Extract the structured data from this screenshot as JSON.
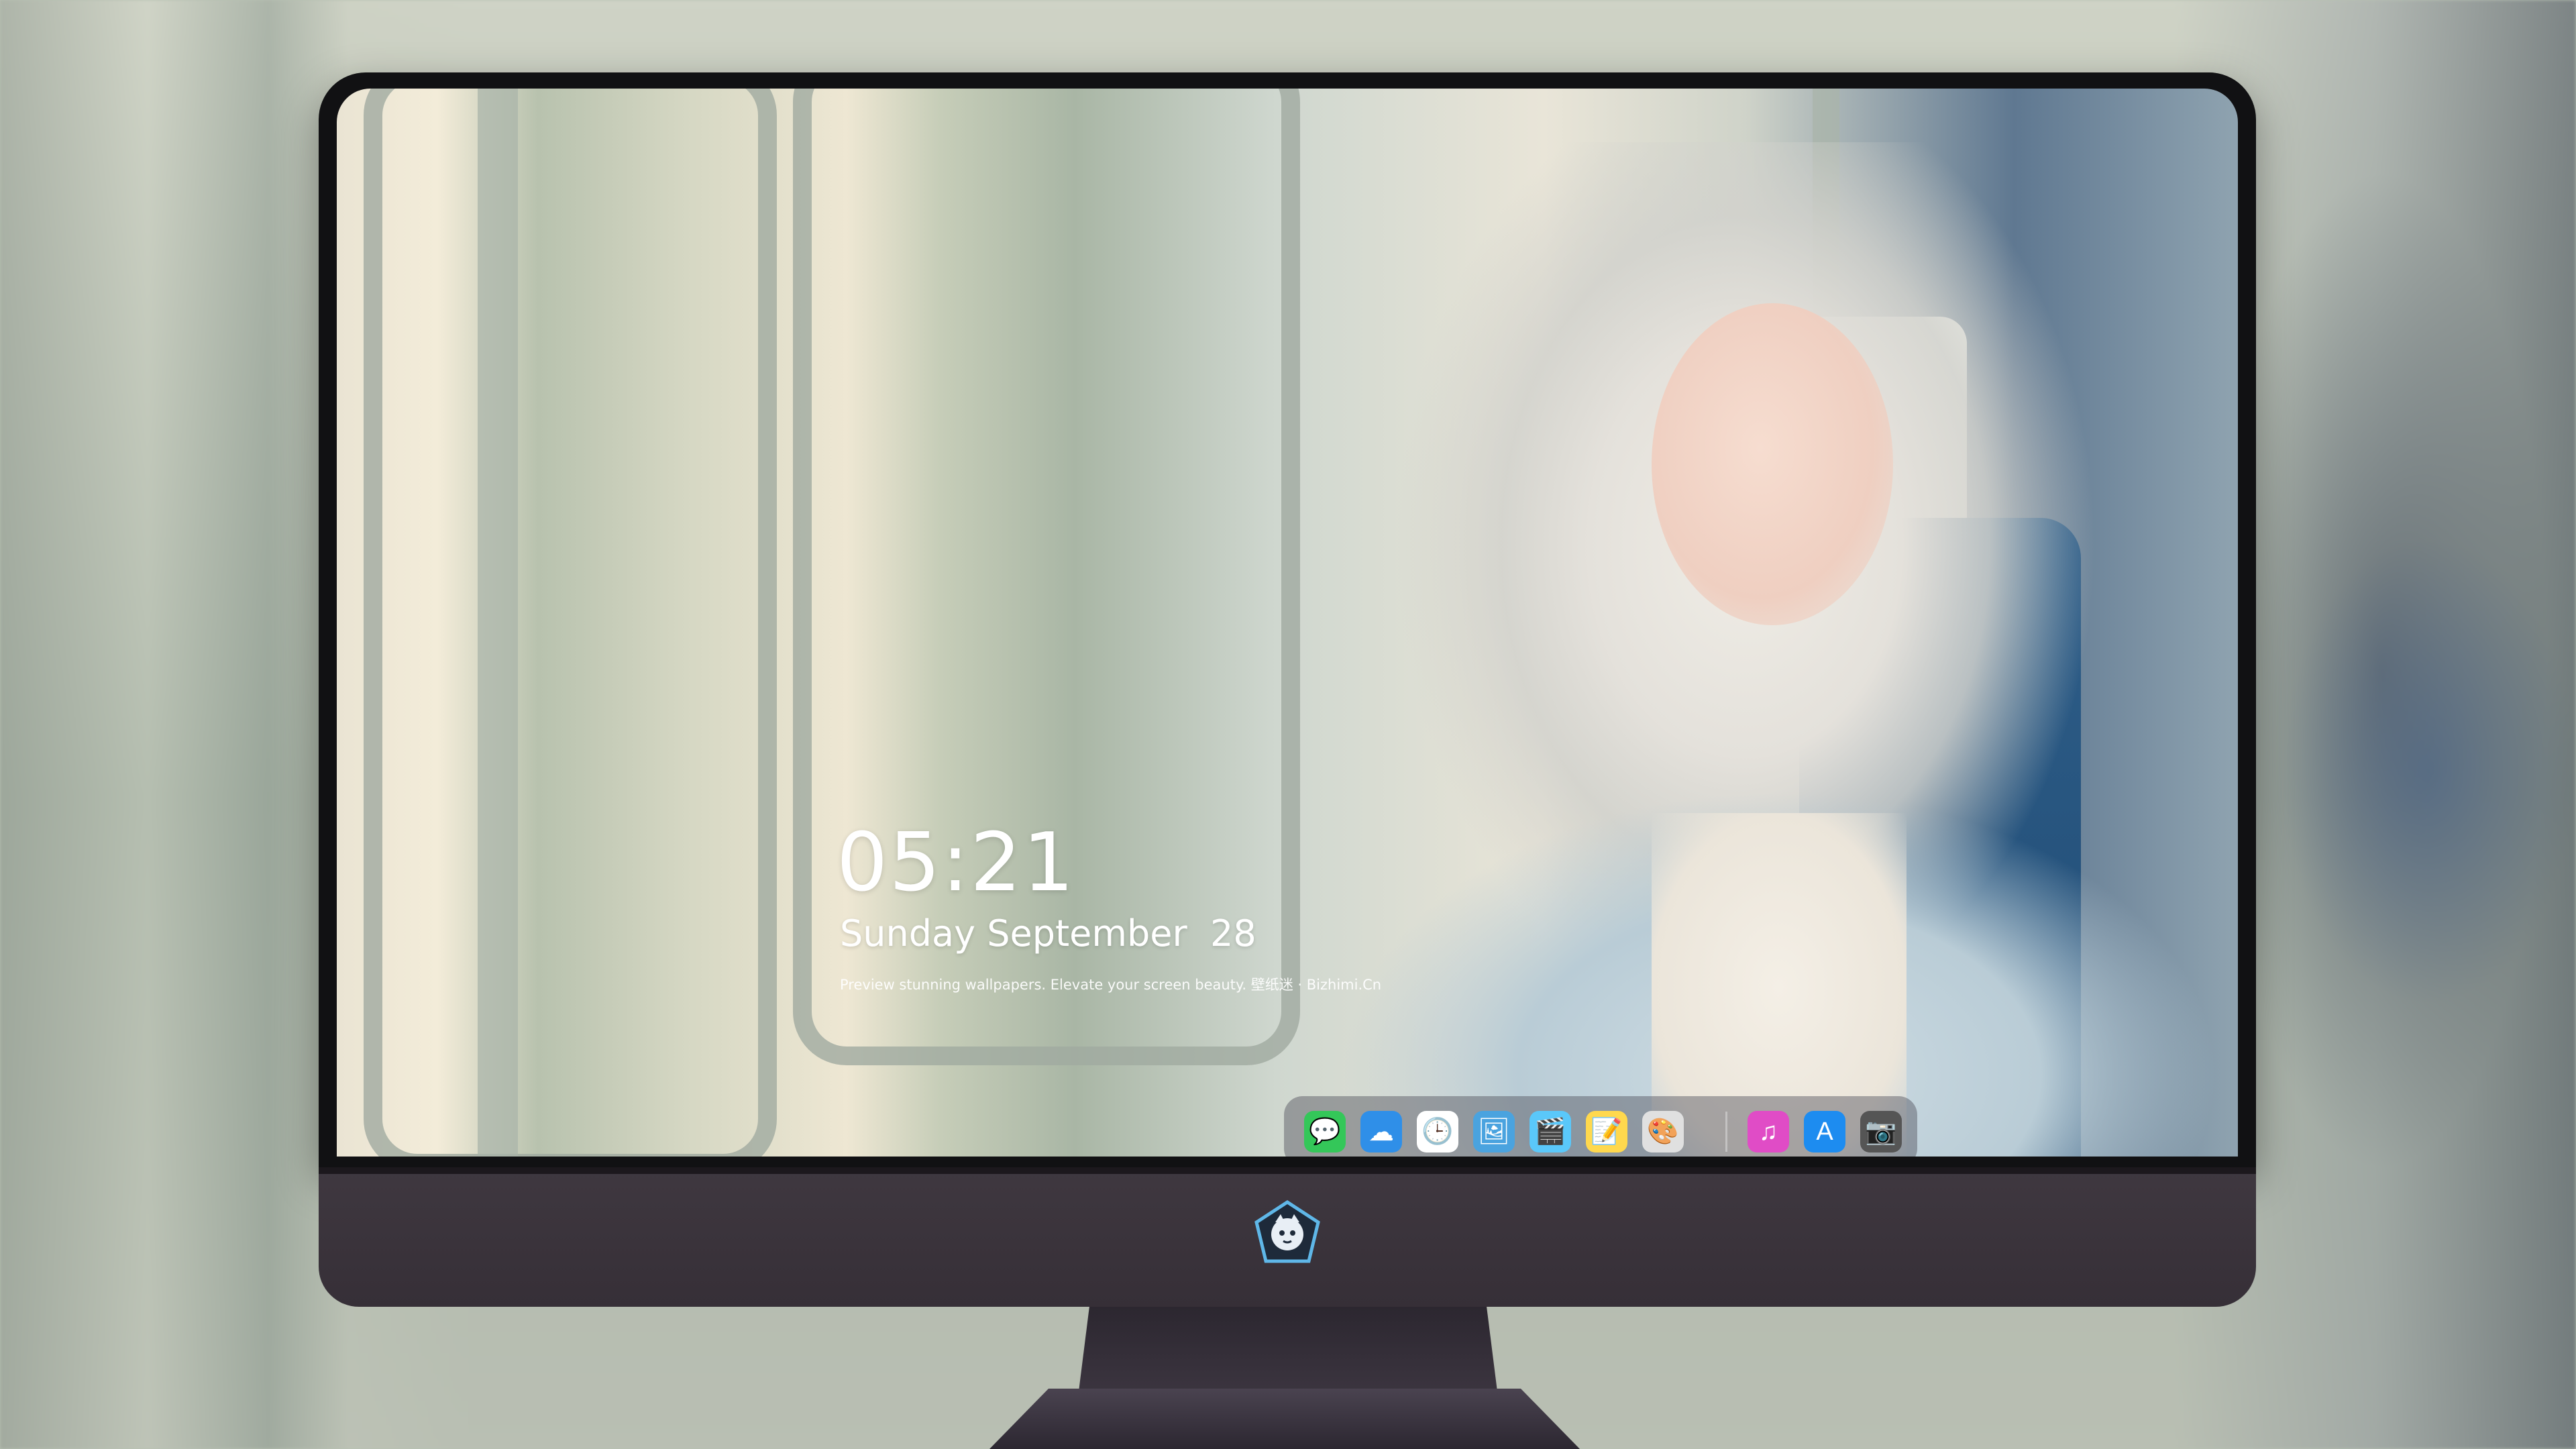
{
  "lockscreen": {
    "time": "05:21",
    "date": "Sunday September  28",
    "tagline": "Preview stunning wallpapers. Elevate your screen beauty. 壁纸迷 · Bizhimi.Cn"
  },
  "dock": {
    "apps": [
      {
        "name": "messages-icon",
        "glyph": "💬",
        "color": "#34c759"
      },
      {
        "name": "weather-icon",
        "glyph": "☁",
        "color": "#2f8fe8"
      },
      {
        "name": "clock-icon",
        "glyph": "🕒",
        "color": "#ffffff"
      },
      {
        "name": "preview-icon",
        "glyph": "🖼",
        "color": "#4aa3df"
      },
      {
        "name": "clips-icon",
        "glyph": "🎬",
        "color": "#5ac8fa"
      },
      {
        "name": "notes-icon",
        "glyph": "📝",
        "color": "#ffd84d"
      },
      {
        "name": "photo-booth-icon",
        "glyph": "🎨",
        "color": "#e0e0e0"
      }
    ],
    "right_apps": [
      {
        "name": "music-icon",
        "glyph": "♫",
        "color": "#e04cc6"
      },
      {
        "name": "app-store-icon",
        "glyph": "A",
        "color": "#1d8cf0"
      },
      {
        "name": "camera-icon",
        "glyph": "📷",
        "color": "#555555"
      }
    ]
  },
  "colors": {
    "bezel": "#111113",
    "chin": "#3f3840",
    "dock_bg": "rgba(80,80,90,0.45)"
  }
}
